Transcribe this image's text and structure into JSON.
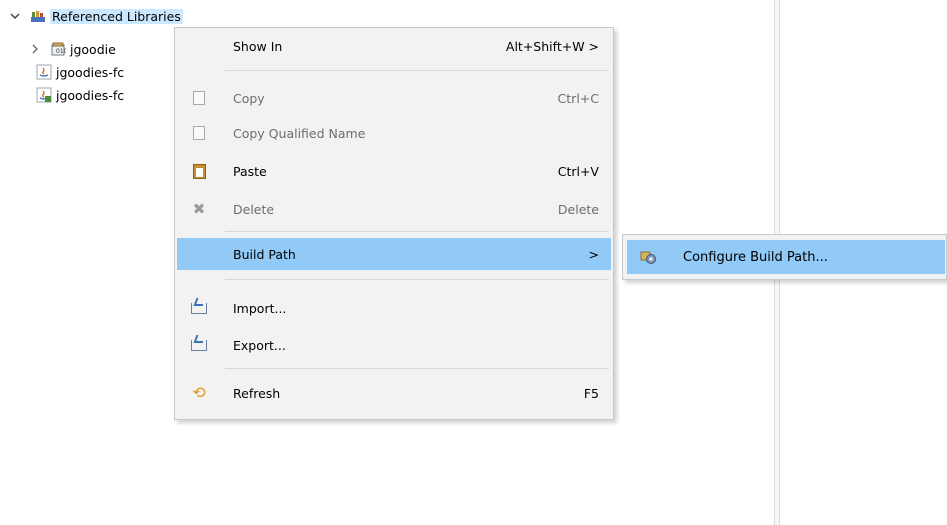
{
  "tree": {
    "root": {
      "label": "Referenced Libraries",
      "expanded": true
    },
    "items": [
      {
        "label": "jgoodie",
        "icon": "jar-icon",
        "expandable": true
      },
      {
        "label": "jgoodies-fc",
        "icon": "java-file-icon",
        "expandable": false
      },
      {
        "label": "jgoodies-fc",
        "icon": "java-file-icon",
        "expandable": false
      }
    ]
  },
  "context_menu": {
    "items": [
      {
        "label": "Show In",
        "accel": "Alt+Shift+W >",
        "icon": "",
        "enabled": true
      },
      {
        "label": "Copy",
        "accel": "Ctrl+C",
        "icon": "copy-icon",
        "enabled": false
      },
      {
        "label": "Copy Qualified Name",
        "accel": "",
        "icon": "copy-qualified-icon",
        "enabled": false
      },
      {
        "label": "Paste",
        "accel": "Ctrl+V",
        "icon": "paste-icon",
        "enabled": true
      },
      {
        "label": "Delete",
        "accel": "Delete",
        "icon": "delete-icon",
        "enabled": false
      },
      {
        "label": "Build Path",
        "accel": ">",
        "icon": "",
        "enabled": true,
        "active": true
      },
      {
        "label": "Import...",
        "accel": "",
        "icon": "import-icon",
        "enabled": true
      },
      {
        "label": "Export...",
        "accel": "",
        "icon": "export-icon",
        "enabled": true
      },
      {
        "label": "Refresh",
        "accel": "F5",
        "icon": "refresh-icon",
        "enabled": true
      }
    ]
  },
  "submenu": {
    "items": [
      {
        "label": "Configure Build Path...",
        "icon": "configure-build-path-icon"
      }
    ]
  },
  "colors": {
    "highlight": "#91c9f7",
    "menu_bg": "#f2f2f2",
    "selection_bg": "#cce8ff"
  }
}
